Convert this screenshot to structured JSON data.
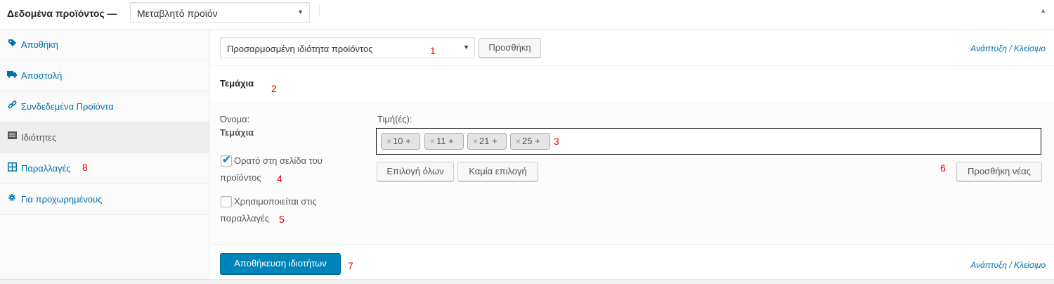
{
  "header": {
    "title": "Δεδομένα προϊόντος —",
    "product_type": "Μεταβλητό προϊόν",
    "toggle_icon": "triangle-up-icon"
  },
  "sidebar": {
    "items": [
      {
        "label": "Αποθήκη",
        "icon": "tag-icon"
      },
      {
        "label": "Αποστολή",
        "icon": "truck-icon"
      },
      {
        "label": "Συνδεδεμένα Προϊόντα",
        "icon": "link-icon"
      },
      {
        "label": "Ιδιότητες",
        "icon": "list-icon",
        "active": true
      },
      {
        "label": "Παραλλαγές",
        "icon": "grid-icon",
        "annotation": "8"
      },
      {
        "label": "Για προχωρημένους",
        "icon": "gear-icon"
      }
    ]
  },
  "toolbar": {
    "attribute_select": "Προσαρμοσμένη ιδιότητα προϊόντος",
    "add_label": "Προσθήκη",
    "expand_close": "Ανάπτυξη / Κλείσιμο"
  },
  "attribute": {
    "title": "Τεμάχια",
    "name_label": "Όνομα:",
    "name_value": "Τεμάχια",
    "visible_label_1": "Ορατό στη σελίδα του",
    "visible_label_2": "προϊόντος",
    "visible_checked": true,
    "variations_label_1": "Χρησιμοποιείται στις",
    "variations_label_2": "παραλλαγές",
    "variations_checked": false,
    "values_label": "Τιμή(ές):",
    "values": [
      "10",
      "11",
      "21",
      "25"
    ],
    "chip_remove": "×",
    "chip_add": "+",
    "select_all": "Επιλογή όλων",
    "select_none": "Καμία επιλογή",
    "add_new": "Προσθήκη νέας"
  },
  "footer": {
    "save_label": "Αποθήκευση ιδιοτήτων",
    "expand_close": "Ανάπτυξη / Κλείσιμο"
  },
  "annotations": {
    "n1": "1",
    "n2": "2",
    "n3": "3",
    "n4": "4",
    "n5": "5",
    "n6": "6",
    "n7": "7"
  },
  "colors": {
    "link": "#0073aa",
    "primary_button": "#0085ba",
    "annotation": "#ee0000"
  }
}
